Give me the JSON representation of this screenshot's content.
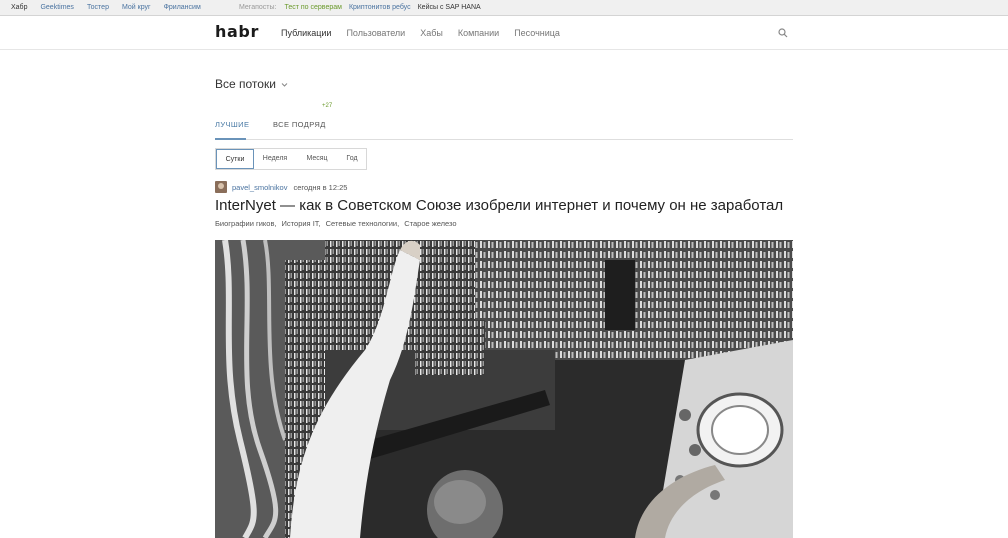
{
  "topbar": {
    "links": [
      "Хабр",
      "Geektimes",
      "Тостер",
      "Мой круг",
      "Фрилансим"
    ],
    "megaposts_label": "Мегапосты:",
    "megaposts": [
      {
        "label": "Тест по серверам",
        "color": "#6b9a2c"
      },
      {
        "label": "Криптонитов ребус",
        "color": "#4a73a0"
      },
      {
        "label": "Кейсы с SAP HANA",
        "color": "#333333"
      }
    ]
  },
  "header": {
    "logo": "habr",
    "nav": [
      "Публикации",
      "Пользователи",
      "Хабы",
      "Компании",
      "Песочница"
    ],
    "search_icon": "search-icon"
  },
  "feed": {
    "stream_title": "Все потоки",
    "tabs": [
      {
        "label": "ЛУЧШИЕ",
        "active": true
      },
      {
        "label": "ВСЕ ПОДРЯД",
        "badge": "+27",
        "active": false
      }
    ],
    "period_filter": [
      {
        "label": "Сутки",
        "active": true
      },
      {
        "label": "Неделя",
        "active": false
      },
      {
        "label": "Месяц",
        "active": false
      },
      {
        "label": "Год",
        "active": false
      }
    ]
  },
  "post": {
    "author": "pavel_smolnikov",
    "time": "сегодня в 12:25",
    "title": "InterNyet — как в Советском Союзе изобрели интернет и почему он не заработал",
    "tags": [
      "Биографии гиков,",
      "История IT,",
      "Сетевые технологии,",
      "Старое железо"
    ],
    "image_description": "black-and-white photo of an engineer working at a large mainframe computer with an oscilloscope"
  },
  "colors": {
    "accent": "#4a7aa5",
    "link": "#4a73a0",
    "badge_green": "#6b9a2c"
  }
}
